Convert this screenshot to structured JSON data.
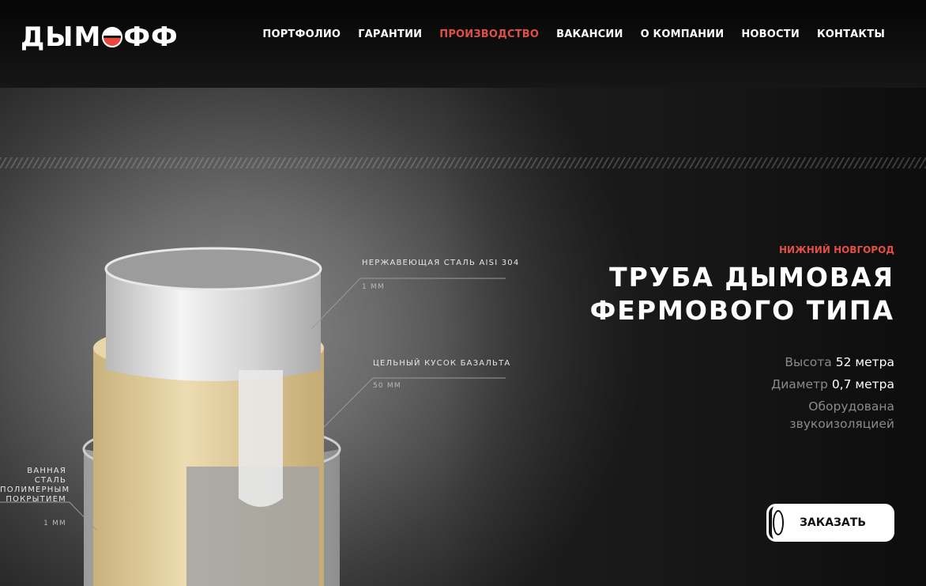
{
  "brand": {
    "logo_left": "ДЫМ",
    "logo_right": "ФФ"
  },
  "nav": {
    "items": [
      {
        "label": "ПОРТФОЛИО"
      },
      {
        "label": "ГАРАНТИИ"
      },
      {
        "label": "ПРОИЗВОДСТВО"
      },
      {
        "label": "ВАКАНСИИ"
      },
      {
        "label": "О КОМПАНИИ"
      },
      {
        "label": "НОВОСТИ"
      },
      {
        "label": "КОНТАКТЫ"
      }
    ],
    "active_index": 2
  },
  "callouts": [
    {
      "title": "НЕРЖАВЕЮЩАЯ СТАЛЬ AISI 304",
      "thickness": "1 ММ"
    },
    {
      "title": "ЦЕЛЬНЫЙ КУСОК БАЗАЛЬТА",
      "thickness": "50 ММ"
    },
    {
      "title_lines": [
        "ВАННАЯ СТАЛЬ",
        "ПОЛИМЕРНЫМ",
        "ПОКРЫТИЕМ"
      ],
      "thickness": "1 ММ"
    }
  ],
  "hero": {
    "city": "НИЖНИЙ НОВГОРОД",
    "title_line1": "ТРУБА ДЫМОВАЯ",
    "title_line2": "ФЕРМОВОГО ТИПА",
    "specs": [
      {
        "label": "Высота",
        "value": "52 метра"
      },
      {
        "label": "Диаметр",
        "value": "0,7 метра"
      },
      {
        "label": "Оборудована",
        "value": ""
      },
      {
        "label": "звукоизоляцией",
        "value": ""
      }
    ],
    "order_button": "ЗАКАЗАТЬ"
  },
  "colors": {
    "accent": "#e25045",
    "header_bg": "#0b0b0b",
    "basalt": "#e0cd9d",
    "steel": "#d9d9d9"
  }
}
